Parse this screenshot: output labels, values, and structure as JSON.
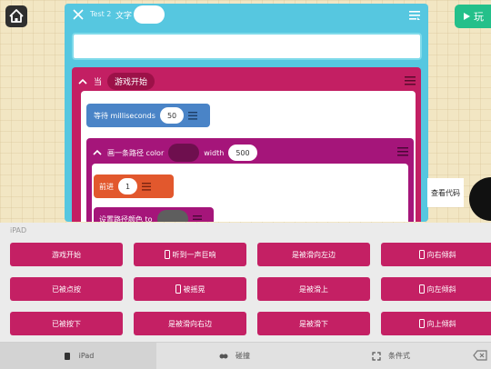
{
  "toolbar": {
    "home_icon": "home-icon",
    "play_label": "玩",
    "play_icon": "play-icon"
  },
  "editor": {
    "title": "Test 2",
    "text_label": "文字",
    "text_value": "",
    "input_value": ""
  },
  "event_block": {
    "prefix": "当",
    "event_name": "游戏开始",
    "wait": {
      "label": "等待 milliseconds",
      "value": "50"
    },
    "draw_path": {
      "label": "画一条路径 color",
      "width_label": "width",
      "width_value": "500",
      "forward": {
        "label": "前进",
        "value": "1"
      },
      "set_color": {
        "label": "设置路径颜色 to"
      }
    }
  },
  "side": {
    "view_code_label": "查看代码"
  },
  "palette": {
    "section_label": "iPAD",
    "rows": [
      [
        {
          "label": "游戏开始",
          "icon": ""
        },
        {
          "label": "听到一声巨响",
          "icon": "phone-icon"
        },
        {
          "label": "是被滑向左边",
          "icon": ""
        },
        {
          "label": "向右倾斜",
          "icon": "phone-icon"
        }
      ],
      [
        {
          "label": "已被点按",
          "icon": ""
        },
        {
          "label": "被摇晃",
          "icon": "phone-icon"
        },
        {
          "label": "是被滑上",
          "icon": ""
        },
        {
          "label": "向左倾斜",
          "icon": "phone-icon"
        }
      ],
      [
        {
          "label": "已被按下",
          "icon": ""
        },
        {
          "label": "是被滑向右边",
          "icon": ""
        },
        {
          "label": "是被滑下",
          "icon": ""
        },
        {
          "label": "向上倾斜",
          "icon": "phone-icon"
        }
      ]
    ]
  },
  "tabs": [
    {
      "label": "iPad",
      "icon": "tablet-icon",
      "active": true
    },
    {
      "label": "碰撞",
      "icon": "collision-icon",
      "active": false
    },
    {
      "label": "条件式",
      "icon": "expand-icon",
      "active": false
    }
  ],
  "colors": {
    "event_block": "#c31f63",
    "wait_block": "#4a84c7",
    "draw_block": "#a5157a",
    "forward_block": "#e2582d",
    "editor_bg": "#56c7e0",
    "play_button": "#24c08a"
  }
}
